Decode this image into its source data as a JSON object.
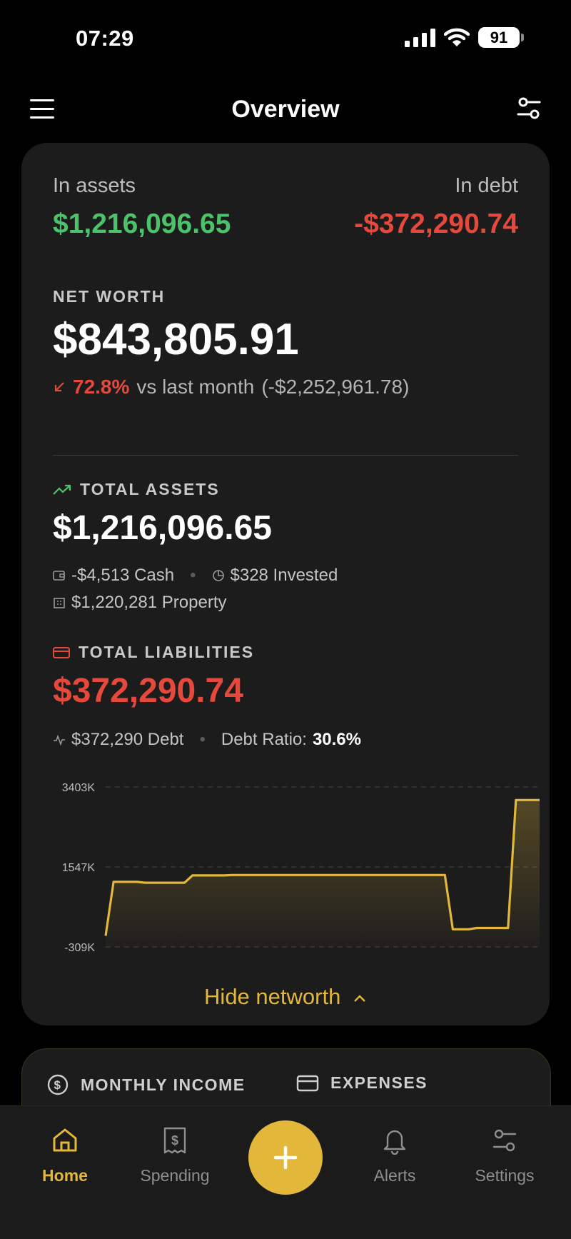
{
  "status": {
    "time": "07:29",
    "battery": "91"
  },
  "header": {
    "title": "Overview"
  },
  "summary": {
    "assets_label": "In assets",
    "assets_value": "$1,216,096.65",
    "debt_label": "In debt",
    "debt_value": "-$372,290.74"
  },
  "networth": {
    "label": "NET WORTH",
    "value": "$843,805.91",
    "change_pct": "72.8%",
    "change_text": "vs last month",
    "change_amount": "(-$2,252,961.78)"
  },
  "assets": {
    "label": "TOTAL ASSETS",
    "value": "$1,216,096.65",
    "cash": "-$4,513 Cash",
    "invested": "$328 Invested",
    "property": "$1,220,281 Property"
  },
  "liabilities": {
    "label": "TOTAL LIABILITIES",
    "value": "$372,290.74",
    "debt": "$372,290 Debt",
    "ratio_label": "Debt Ratio:",
    "ratio_value": "30.6%"
  },
  "chart_data": {
    "type": "area",
    "ylim": [
      -309,
      3403
    ],
    "ytick_labels": [
      "3403K",
      "1547K",
      "-309K"
    ],
    "yticks": [
      3403,
      1547,
      -309
    ],
    "x": [
      0,
      1,
      2,
      3,
      4,
      5,
      6,
      7,
      8,
      9,
      10,
      11,
      12,
      13,
      14,
      15,
      16,
      17,
      18,
      19,
      20,
      21,
      22,
      23,
      24,
      25,
      26,
      27,
      28,
      29,
      30,
      31,
      32,
      33,
      34,
      35,
      36,
      37,
      38,
      39,
      40,
      41,
      42,
      43,
      44,
      45,
      46,
      47,
      48,
      49,
      50,
      51,
      52,
      53,
      54,
      55
    ],
    "values": [
      -50,
      1200,
      1200,
      1200,
      1200,
      1180,
      1180,
      1180,
      1180,
      1180,
      1180,
      1350,
      1350,
      1350,
      1350,
      1350,
      1360,
      1360,
      1360,
      1360,
      1360,
      1360,
      1360,
      1360,
      1360,
      1360,
      1360,
      1360,
      1360,
      1360,
      1360,
      1360,
      1360,
      1360,
      1360,
      1360,
      1360,
      1360,
      1360,
      1360,
      1360,
      1360,
      1360,
      1360,
      100,
      100,
      100,
      130,
      130,
      130,
      130,
      130,
      3100,
      3100,
      3100,
      3100
    ],
    "line_color": "#e3b83a",
    "grid": true
  },
  "hide_button": "Hide networth",
  "cards": {
    "income": "MONTHLY INCOME",
    "expenses": "EXPENSES"
  },
  "nav": {
    "home": "Home",
    "spending": "Spending",
    "alerts": "Alerts",
    "settings": "Settings"
  },
  "colors": {
    "accent": "#e3b83a",
    "positive": "#4cc36a",
    "negative": "#e4493b"
  }
}
